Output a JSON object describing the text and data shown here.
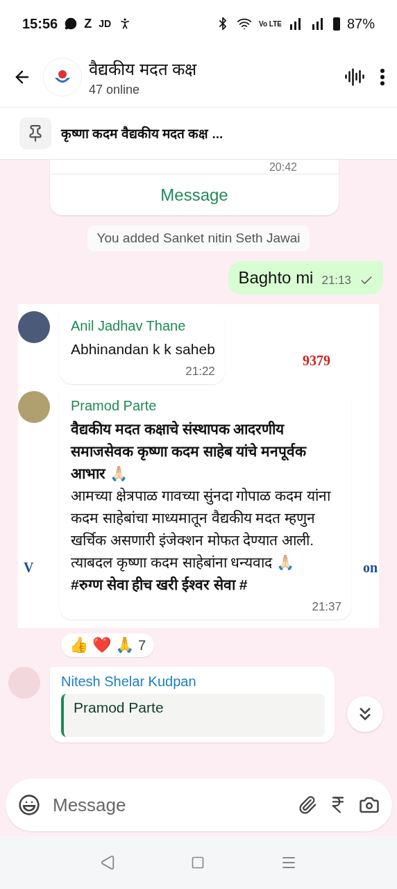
{
  "status_bar": {
    "time": "15:56",
    "left_glyphs": [
      "Z",
      "JD"
    ],
    "network_label": "Vo LTE",
    "battery": "87%"
  },
  "header": {
    "title": "वैद्यकीय मदत कक्ष",
    "subtitle": "47 online"
  },
  "pinned": {
    "text": "कृष्णा कदम वैद्यकीय मदत कक्ष ..."
  },
  "messages": [
    {
      "kind": "card",
      "time": "20:42",
      "action": "Message"
    },
    {
      "kind": "system",
      "text": "You added Sanket nitin Seth Jawai"
    },
    {
      "kind": "outgoing",
      "text": "Baghto mi",
      "time": "21:13",
      "delivered": true
    },
    {
      "kind": "incoming",
      "sender": "Anil Jadhav Thane",
      "color": "#1e8a55",
      "text": "Abhinandan k k saheb",
      "time": "21:22",
      "backdrop": "9379"
    },
    {
      "kind": "incoming",
      "sender": "Pramod Parte",
      "color": "#1e8a55",
      "text": "**वैद्यकीय मदत कक्षाचे संस्थापक आदरणीय समाजसेवक कृष्णा कदम साहेब यांचे मनपूर्वक आभार** 🙏🏻\nआमच्या क्षेत्रपाळ गावच्या सुंनदा गोपाळ कदम यांना कदम साहेबांचा माध्यमातून वैद्यकीय मदत म्हणुन खर्चिक असणारी इंजेक्शन मोफत देण्यात आली. त्याबदल कृष्णा कदम साहेबांना धन्यवाद 🙏🏻\n**#रुग्ण सेवा हीच खरी ईश्वर सेवा #**",
      "time": "21:37",
      "backdrop_left": "V",
      "backdrop_right": "on",
      "reactions": [
        "👍",
        "❤️",
        "🙏"
      ],
      "reaction_count": "7"
    },
    {
      "kind": "reply",
      "sender": "Nitesh Shelar Kudpan",
      "color": "#1b7fc0",
      "quoted_sender": "Pramod Parte"
    }
  ],
  "composer": {
    "placeholder": "Message"
  }
}
